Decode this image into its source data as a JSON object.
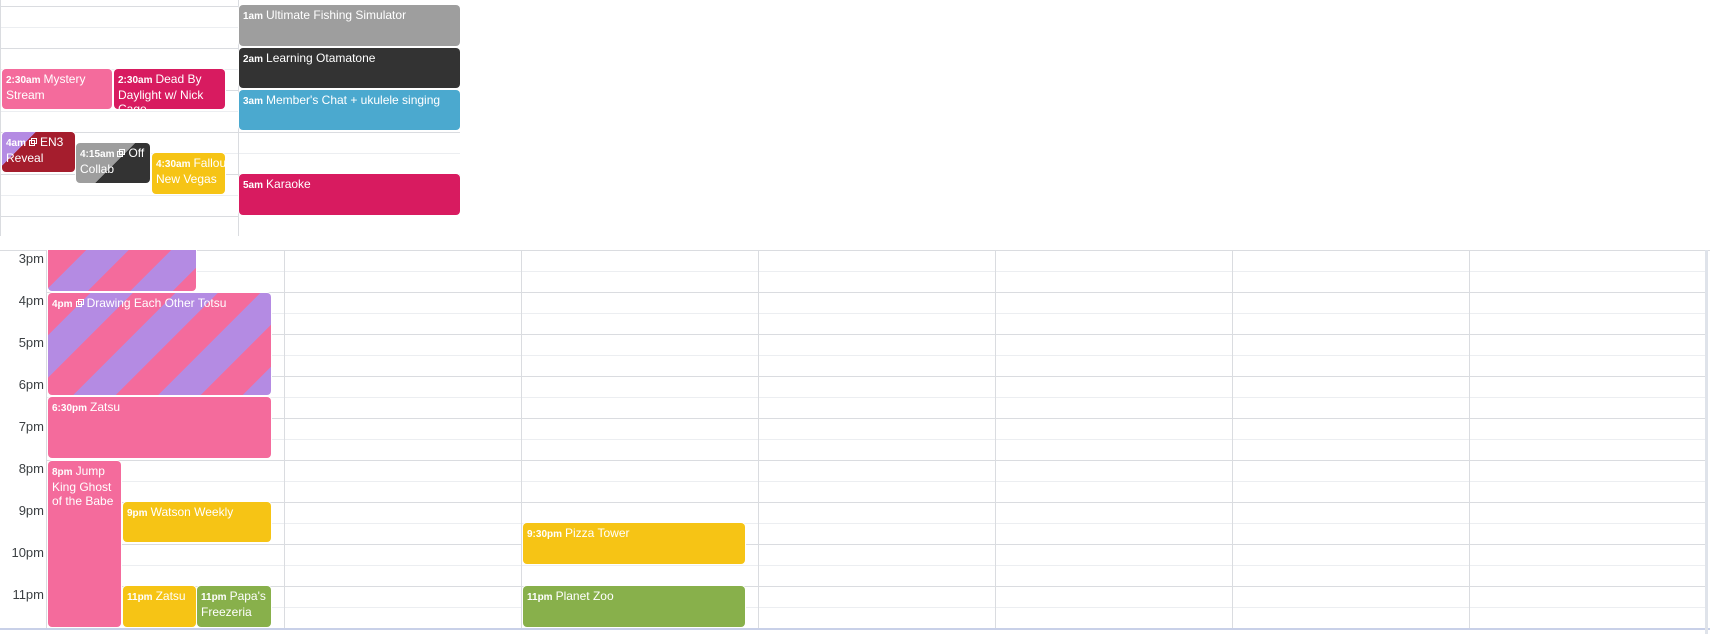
{
  "colors": {
    "pink": "#f46b9c",
    "magenta": "#d81b60",
    "gray": "#9e9e9e",
    "dark": "#333333",
    "teal": "#4ba9cf",
    "yellow": "#f6c415",
    "green": "#88b04b",
    "purple": "#b48be3",
    "red": "#a51d2d"
  },
  "top_events": [
    {
      "time": "1am",
      "title": "Ultimate Fishing Simulator",
      "color": "gray"
    },
    {
      "time": "2am",
      "title": "Learning Otamatone",
      "color": "dark"
    },
    {
      "time": "3am",
      "title": "Member's Chat + ukulele singing",
      "color": "teal"
    },
    {
      "time": "5am",
      "title": "Karaoke",
      "color": "magenta"
    },
    {
      "time": "2:30am",
      "title": "Mystery Stream",
      "color": "pink"
    },
    {
      "time": "2:30am",
      "title": "Dead By Daylight w/ Nick Cage",
      "color": "magenta"
    },
    {
      "time": "4am",
      "title": "EN3 Reveal",
      "color": "purple+red",
      "icon": "copy-icon"
    },
    {
      "time": "4:15am",
      "title": "Off Collab",
      "color": "gray+dark",
      "icon": "copy-icon"
    },
    {
      "time": "4:30am",
      "title": "Fallout: New Vegas",
      "color": "yellow"
    }
  ],
  "bottom": {
    "hours": [
      "3pm",
      "4pm",
      "5pm",
      "6pm",
      "7pm",
      "8pm",
      "9pm",
      "10pm",
      "11pm"
    ],
    "events": [
      {
        "time": "",
        "title": "",
        "color": "pink+purple"
      },
      {
        "time": "4pm",
        "title": "Drawing Each Other Totsu",
        "color": "pink+purple",
        "icon": "copy-icon"
      },
      {
        "time": "6:30pm",
        "title": "Zatsu",
        "color": "pink"
      },
      {
        "time": "8pm",
        "title": "Jump King Ghost of the Babe",
        "color": "pink"
      },
      {
        "time": "9pm",
        "title": "Watson Weekly",
        "color": "yellow"
      },
      {
        "time": "11pm",
        "title": "Zatsu",
        "color": "yellow"
      },
      {
        "time": "11pm",
        "title": "Papa's Freezeria",
        "color": "green"
      },
      {
        "time": "9:30pm",
        "title": "Pizza Tower",
        "color": "yellow"
      },
      {
        "time": "11pm",
        "title": "Planet Zoo",
        "color": "green"
      }
    ]
  }
}
